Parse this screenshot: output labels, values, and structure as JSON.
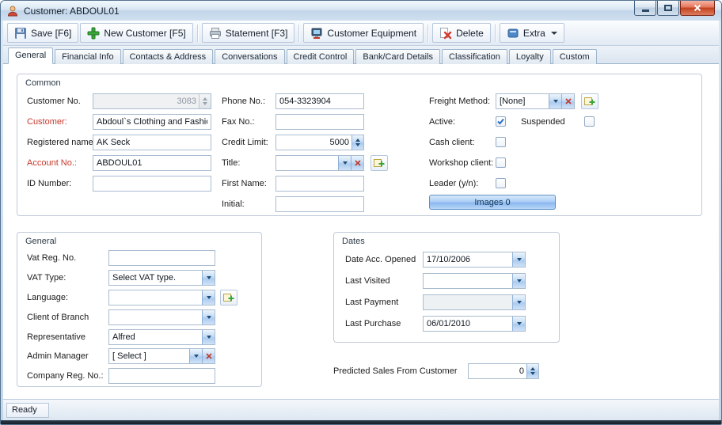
{
  "window": {
    "title": "Customer: ABDOUL01"
  },
  "toolbar": {
    "save": "Save [F6]",
    "new_customer": "New Customer [F5]",
    "statement": "Statement [F3]",
    "customer_equipment": "Customer Equipment",
    "delete": "Delete",
    "extra": "Extra"
  },
  "tabs": {
    "active": "General",
    "items": [
      "General",
      "Financial Info",
      "Contacts & Address",
      "Conversations",
      "Credit Control",
      "Bank/Card Details",
      "Classification",
      "Loyalty",
      "Custom"
    ]
  },
  "common": {
    "title": "Common",
    "customer_no": {
      "label": "Customer No.",
      "value": "3083"
    },
    "customer": {
      "label": "Customer:",
      "value": "Abdoul`s Clothing and Fashio"
    },
    "registered_name": {
      "label": "Registered name:",
      "value": "AK Seck"
    },
    "account_no": {
      "label": "Account No.:",
      "value": "ABDOUL01"
    },
    "id_number": {
      "label": "ID Number:",
      "value": ""
    },
    "phone": {
      "label": "Phone No.:",
      "value": "054-3323904"
    },
    "fax": {
      "label": "Fax No.:",
      "value": ""
    },
    "credit_limit": {
      "label": "Credit Limit:",
      "value": "5000"
    },
    "title_field": {
      "label": "Title:",
      "value": ""
    },
    "first_name": {
      "label": "First Name:",
      "value": ""
    },
    "initial": {
      "label": "Initial:",
      "value": ""
    },
    "freight_method": {
      "label": "Freight Method:",
      "value": "[None]"
    },
    "active": {
      "label": "Active:",
      "checked": true
    },
    "suspended": {
      "label": "Suspended",
      "checked": false
    },
    "cash_client": {
      "label": "Cash client:",
      "checked": false
    },
    "workshop_client": {
      "label": "Workshop client:",
      "checked": false
    },
    "leader": {
      "label": "Leader (y/n):",
      "checked": false
    },
    "images_button": "Images 0"
  },
  "general": {
    "title": "General",
    "vat_reg_no": {
      "label": "Vat Reg. No.",
      "value": ""
    },
    "vat_type": {
      "label": "VAT Type:",
      "value": "Select VAT type."
    },
    "language": {
      "label": "Language:",
      "value": ""
    },
    "client_of_branch": {
      "label": "Client of Branch",
      "value": ""
    },
    "representative": {
      "label": "Representative",
      "value": "Alfred"
    },
    "admin_manager": {
      "label": "Admin Manager",
      "value": "[ Select ]"
    },
    "company_reg_no": {
      "label": "Company Reg. No.:",
      "value": ""
    }
  },
  "dates": {
    "title": "Dates",
    "date_acc_opened": {
      "label": "Date Acc. Opened",
      "value": "17/10/2006"
    },
    "last_visited": {
      "label": "Last Visited",
      "value": ""
    },
    "last_payment": {
      "label": "Last Payment",
      "value": ""
    },
    "last_purchase": {
      "label": "Last Purchase",
      "value": "06/01/2010"
    }
  },
  "predicted_sales": {
    "label": "Predicted Sales From Customer",
    "value": "0"
  },
  "statusbar": {
    "text": "Ready"
  }
}
